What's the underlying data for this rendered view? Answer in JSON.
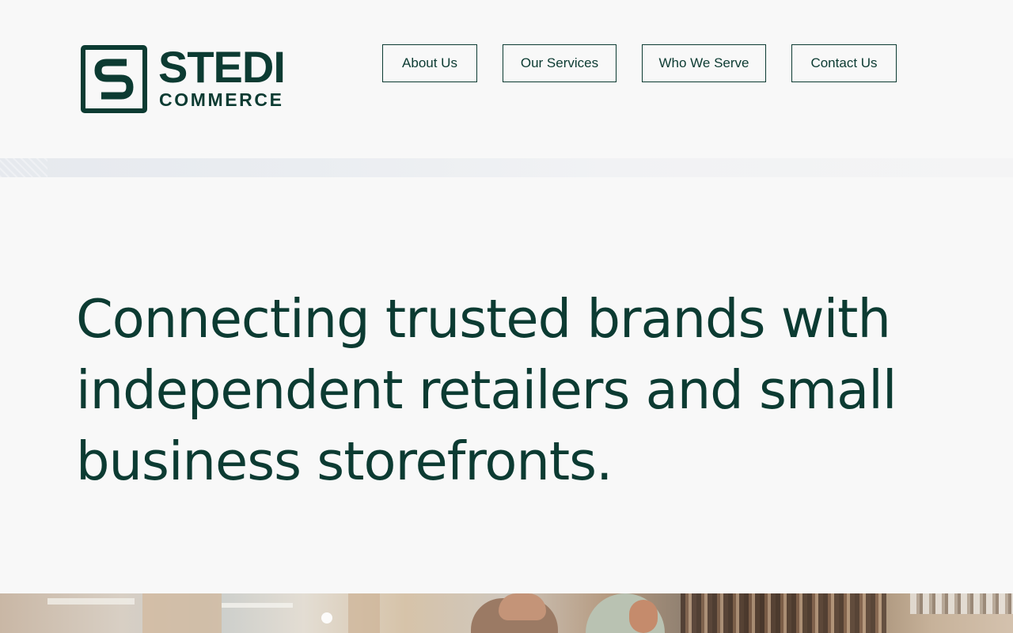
{
  "brand": {
    "name": "STEDI",
    "sub": "COMMERCE",
    "color": "#0c3b32"
  },
  "nav": {
    "items": [
      {
        "label": "About Us"
      },
      {
        "label": "Our Services"
      },
      {
        "label": "Who We Serve"
      },
      {
        "label": "Contact Us"
      }
    ]
  },
  "hero": {
    "heading": "Connecting trusted brands with independent retailers and small business storefronts."
  },
  "colors": {
    "background": "#f8f8f8",
    "primary": "#0c3b32"
  }
}
